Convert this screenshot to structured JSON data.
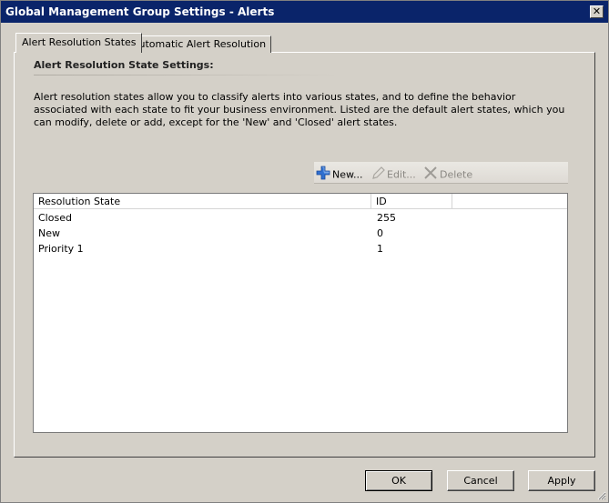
{
  "window": {
    "title": "Global Management Group Settings - Alerts",
    "close_glyph": "✕"
  },
  "tabs": [
    {
      "label": "Alert Resolution States",
      "active": true
    },
    {
      "label": "Automatic Alert Resolution",
      "active": false
    }
  ],
  "section": {
    "title": "Alert Resolution State Settings:",
    "description": "Alert resolution states allow you to classify alerts into various states, and to define the behavior associated with each state to fit your business environment. Listed are the default alert states, which you can modify, delete or add, except for the 'New' and 'Closed' alert states."
  },
  "toolbar": {
    "new_label": "New...",
    "edit_label": "Edit...",
    "delete_label": "Delete",
    "new_icon": "plus-icon",
    "edit_icon": "pencil-icon",
    "delete_icon": "x-icon"
  },
  "table": {
    "columns": [
      "Resolution State",
      "ID",
      ""
    ],
    "rows": [
      {
        "state": "Closed",
        "id": "255"
      },
      {
        "state": "New",
        "id": "0"
      },
      {
        "state": "Priority 1",
        "id": "1"
      }
    ]
  },
  "buttons": {
    "ok": "OK",
    "cancel": "Cancel",
    "apply": "Apply"
  },
  "colors": {
    "titlebar": "#0a246a",
    "dialog_bg": "#d4d0c8",
    "plus_icon": "#2f6fd0"
  }
}
